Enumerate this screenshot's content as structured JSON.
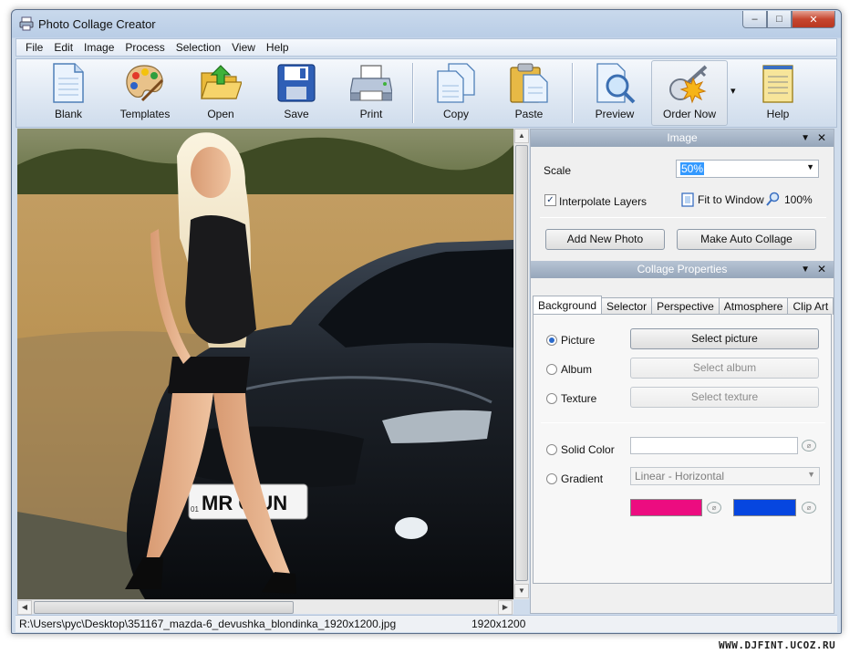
{
  "window": {
    "title": "Photo Collage Creator",
    "controls": [
      "–",
      "□",
      "✕"
    ]
  },
  "menu": [
    "File",
    "Edit",
    "Image",
    "Process",
    "Selection",
    "View",
    "Help"
  ],
  "toolbar": {
    "blank": "Blank",
    "templates": "Templates",
    "open": "Open",
    "save": "Save",
    "print": "Print",
    "copy": "Copy",
    "paste": "Paste",
    "preview": "Preview",
    "order_now": "Order Now",
    "order_dropdown": "▾",
    "help": "Help"
  },
  "image_panel": {
    "header": "Image",
    "scale_label": "Scale",
    "scale_value": "50%",
    "interpolate_label": "Interpolate Layers",
    "interpolate_checked": "✓",
    "fit_to_window": "Fit to Window",
    "hundred_percent": "100%",
    "add_photo": "Add New Photo",
    "auto_collage": "Make Auto Collage"
  },
  "collage_panel": {
    "header": "Collage Properties",
    "tabs": [
      "Background",
      "Selector",
      "Perspective",
      "Atmosphere",
      "Clip Art"
    ],
    "picture_label": "Picture",
    "select_picture": "Select picture",
    "album_label": "Album",
    "select_album": "Select album",
    "texture_label": "Texture",
    "select_texture": "Select texture",
    "solid_color_label": "Solid Color",
    "gradient_label": "Gradient",
    "gradient_type": "Linear - Horizontal",
    "gradient_color_1": "#ec0c80",
    "gradient_color_2": "#0646e0"
  },
  "canvas": {
    "plate_text": "MR C   UN",
    "plate_small": "01"
  },
  "status": {
    "path": "R:\\Users\\рус\\Desktop\\351167_mazda-6_devushka_blondinka_1920x1200.jpg",
    "dimensions": "1920x1200"
  },
  "watermark": "WWW.DJFINT.UCOZ.RU",
  "colors": {
    "panel_header": "#9aa9bd",
    "accent": "#2a6acb"
  }
}
